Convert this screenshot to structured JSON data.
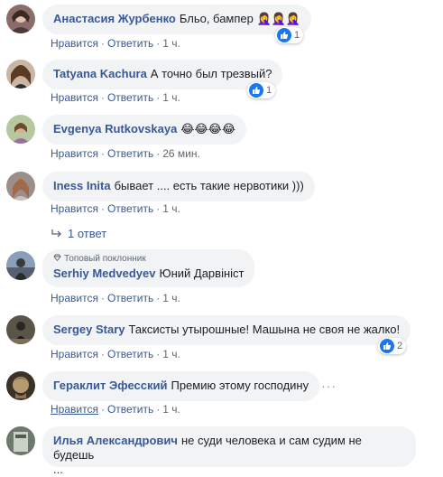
{
  "comments": [
    {
      "author": "Анастасия Журбенко",
      "text": "Бльо, бампер 🤦‍♀️🤦‍♀️🤦‍♀️",
      "reactions": "1",
      "actions": {
        "like": "Нравится",
        "reply": "Ответить",
        "time": "1 ч."
      }
    },
    {
      "author": "Tatyana Kachura",
      "text": "А точно был трезвый?",
      "reactions": "1",
      "actions": {
        "like": "Нравится",
        "reply": "Ответить",
        "time": "1 ч."
      }
    },
    {
      "author": "Evgenya Rutkovskaya",
      "text": "😂😂😂😂",
      "actions": {
        "like": "Нравится",
        "reply": "Ответить",
        "time": "26 мин."
      }
    },
    {
      "author": "Iness Inita",
      "text": "бывает .... есть такие нервотики )))",
      "actions": {
        "like": "Нравится",
        "reply": "Ответить",
        "time": "1 ч."
      },
      "replies": "1 ответ"
    },
    {
      "badge": "Топовый поклонник",
      "author": "Serhiy Medvedyev",
      "text": "Юний Дарвініст",
      "actions": {
        "like": "Нравится",
        "reply": "Ответить",
        "time": "1 ч."
      }
    },
    {
      "author": "Sergey Stary",
      "text": "Таксисты утырошные! Машына не своя не жалко!",
      "reactions": "2",
      "actions": {
        "like": "Нравится",
        "reply": "Ответить",
        "time": "1 ч."
      }
    },
    {
      "author": "Гераклит Эфесский",
      "text": "Премию этому господину",
      "more": "···",
      "actions": {
        "like": "Нравится",
        "reply": "Ответить",
        "time": "1 ч."
      }
    },
    {
      "author": "Илья Александрович",
      "text": "не суди человека и сам судим не будешь",
      "text2": "..."
    }
  ],
  "colors": {
    "author": "#385898",
    "bubble": "#f2f3f5",
    "like_blue": "#1877f2",
    "meta": "#606770"
  }
}
